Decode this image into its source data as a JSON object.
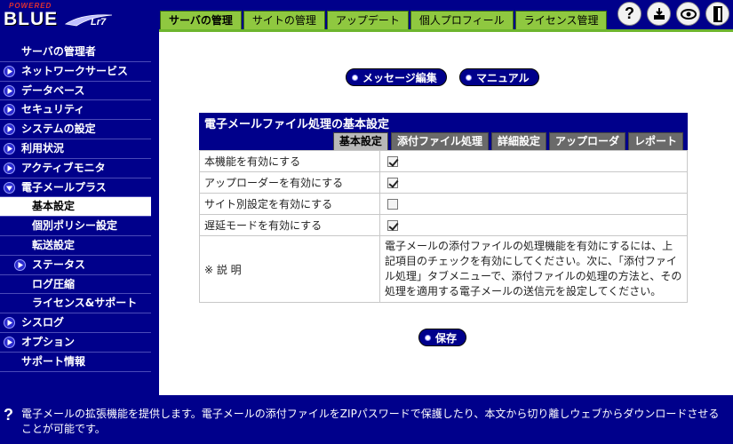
{
  "logo": {
    "powered": "POWERED",
    "brand": "BLUE"
  },
  "tabs": [
    {
      "label": "サーバの管理",
      "active": true
    },
    {
      "label": "サイトの管理",
      "active": false
    },
    {
      "label": "アップデート",
      "active": false
    },
    {
      "label": "個人プロフィール",
      "active": false
    },
    {
      "label": "ライセンス管理",
      "active": false
    }
  ],
  "top_icons": [
    "help-icon",
    "logout-icon",
    "view-icon",
    "exit-icon"
  ],
  "sidebar": {
    "items": [
      {
        "label": "サーバの管理者",
        "level": 0,
        "arrow": "none"
      },
      {
        "label": "ネットワークサービス",
        "level": 0,
        "arrow": "right"
      },
      {
        "label": "データベース",
        "level": 0,
        "arrow": "right"
      },
      {
        "label": "セキュリティ",
        "level": 0,
        "arrow": "right"
      },
      {
        "label": "システムの設定",
        "level": 0,
        "arrow": "right"
      },
      {
        "label": "利用状況",
        "level": 0,
        "arrow": "right"
      },
      {
        "label": "アクティブモニタ",
        "level": 0,
        "arrow": "right"
      },
      {
        "label": "電子メールプラス",
        "level": 0,
        "arrow": "down"
      },
      {
        "label": "基本設定",
        "level": 1,
        "arrow": "none",
        "selected": true
      },
      {
        "label": "個別ポリシー設定",
        "level": 1,
        "arrow": "none"
      },
      {
        "label": "転送設定",
        "level": 1,
        "arrow": "none"
      },
      {
        "label": "ステータス",
        "level": 1,
        "arrow": "right"
      },
      {
        "label": "ログ圧縮",
        "level": 1,
        "arrow": "none"
      },
      {
        "label": "ライセンス&サポート",
        "level": 1,
        "arrow": "none"
      },
      {
        "label": "シスログ",
        "level": 0,
        "arrow": "right"
      },
      {
        "label": "オプション",
        "level": 0,
        "arrow": "right"
      },
      {
        "label": "サポート情報",
        "level": 0,
        "arrow": "none"
      }
    ]
  },
  "buttons": {
    "edit_message": "メッセージ編集",
    "manual": "マニュアル",
    "save": "保存"
  },
  "panel": {
    "title": "電子メールファイル処理の基本設定",
    "subtabs": [
      {
        "label": "基本設定",
        "active": true
      },
      {
        "label": "添付ファイル処理",
        "active": false
      },
      {
        "label": "詳細設定",
        "active": false
      },
      {
        "label": "アップローダ",
        "active": false
      },
      {
        "label": "レポート",
        "active": false
      }
    ],
    "rows": [
      {
        "label": "本機能を有効にする",
        "checked": true
      },
      {
        "label": "アップローダーを有効にする",
        "checked": true
      },
      {
        "label": "サイト別設定を有効にする",
        "checked": false
      },
      {
        "label": "遅延モードを有効にする",
        "checked": true
      }
    ],
    "description_label": "※ 説 明",
    "description_text": "電子メールの添付ファイルの処理機能を有効にするには、上記項目のチェックを有効にしてください。次に、「添付ファイル処理」タブメニューで、添付ファイルの処理の方法と、その処理を適用する電子メールの送信元を設定してください。"
  },
  "help": {
    "icon": "question-icon",
    "text": "電子メールの拡張機能を提供します。電子メールの添付ファイルをZIPパスワードで保護したり、本文から切り離しウェブからダウンロードさせることが可能です。"
  },
  "colors": {
    "navy": "#00008b",
    "tab_green": "#8fc840",
    "subtab_gray": "#6a6a6a",
    "subtab_active": "#b8b8b8"
  }
}
